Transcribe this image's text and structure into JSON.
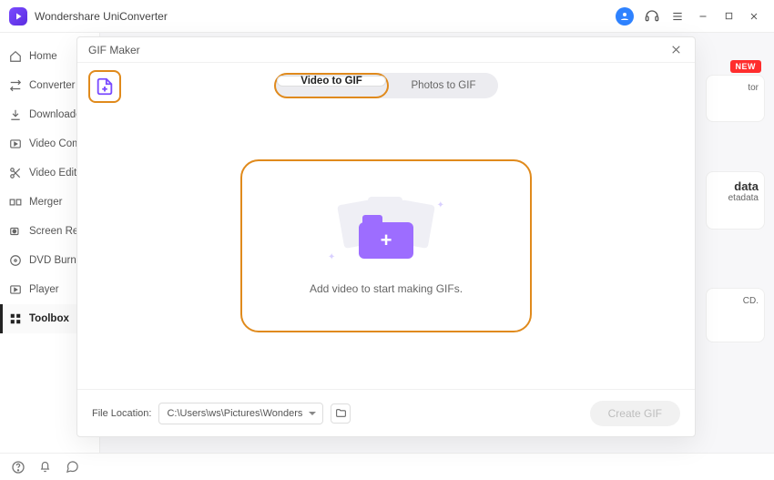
{
  "app": {
    "title": "Wondershare UniConverter"
  },
  "window": {
    "avatar_initial": ""
  },
  "sidebar": {
    "items": [
      {
        "label": "Home"
      },
      {
        "label": "Converter"
      },
      {
        "label": "Downloader"
      },
      {
        "label": "Video Compressor"
      },
      {
        "label": "Video Editor"
      },
      {
        "label": "Merger"
      },
      {
        "label": "Screen Recorder"
      },
      {
        "label": "DVD Burner"
      },
      {
        "label": "Player"
      },
      {
        "label": "Toolbox"
      }
    ],
    "active_index": 9
  },
  "peek": {
    "badge": "NEW",
    "card1_suffix": "tor",
    "card2_title_suffix": "data",
    "card2_sub_suffix": "etadata",
    "card3_suffix": "CD."
  },
  "modal": {
    "title": "GIF Maker",
    "tabs": {
      "video": "Video to GIF",
      "photos": "Photos to GIF",
      "active": "video"
    },
    "dropzone_text": "Add video to start making GIFs.",
    "footer": {
      "label": "File Location:",
      "path": "C:\\Users\\ws\\Pictures\\Wonders",
      "create_label": "Create GIF"
    }
  }
}
